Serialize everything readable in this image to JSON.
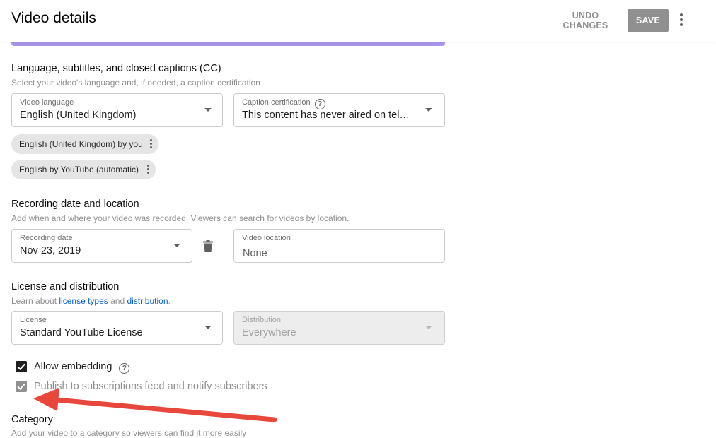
{
  "header": {
    "title": "Video details",
    "undo_label": "UNDO CHANGES",
    "save_label": "SAVE"
  },
  "language_section": {
    "title": "Language, subtitles, and closed captions (CC)",
    "description": "Select your video's language and, if needed, a caption certification",
    "video_language": {
      "label": "Video language",
      "value": "English (United Kingdom)"
    },
    "caption_certification": {
      "label": "Caption certification",
      "value": "This content has never aired on televis..."
    },
    "chips": [
      {
        "label": "English (United Kingdom) by you"
      },
      {
        "label": "English by YouTube (automatic)"
      }
    ]
  },
  "recording_section": {
    "title": "Recording date and location",
    "description": "Add when and where your video was recorded. Viewers can search for videos by location.",
    "recording_date": {
      "label": "Recording date",
      "value": "Nov 23, 2019"
    },
    "video_location": {
      "label": "Video location",
      "placeholder": "None"
    }
  },
  "license_section": {
    "title": "License and distribution",
    "description_prefix": "Learn about ",
    "link1": "license types",
    "description_middle": " and ",
    "link2": "distribution",
    "description_suffix": ".",
    "license": {
      "label": "License",
      "value": "Standard YouTube License"
    },
    "distribution": {
      "label": "Distribution",
      "value": "Everywhere"
    }
  },
  "checkboxes": {
    "allow_embedding": {
      "label": "Allow embedding",
      "checked": true
    },
    "publish_feed": {
      "label": "Publish to subscriptions feed and notify subscribers",
      "checked": true
    }
  },
  "category_section": {
    "title": "Category",
    "description": "Add your video to a category so viewers can find it more easily"
  },
  "colors": {
    "accent_purple": "#a895e8",
    "link_blue": "#065fd4",
    "annotation_arrow": "#e8473b"
  }
}
